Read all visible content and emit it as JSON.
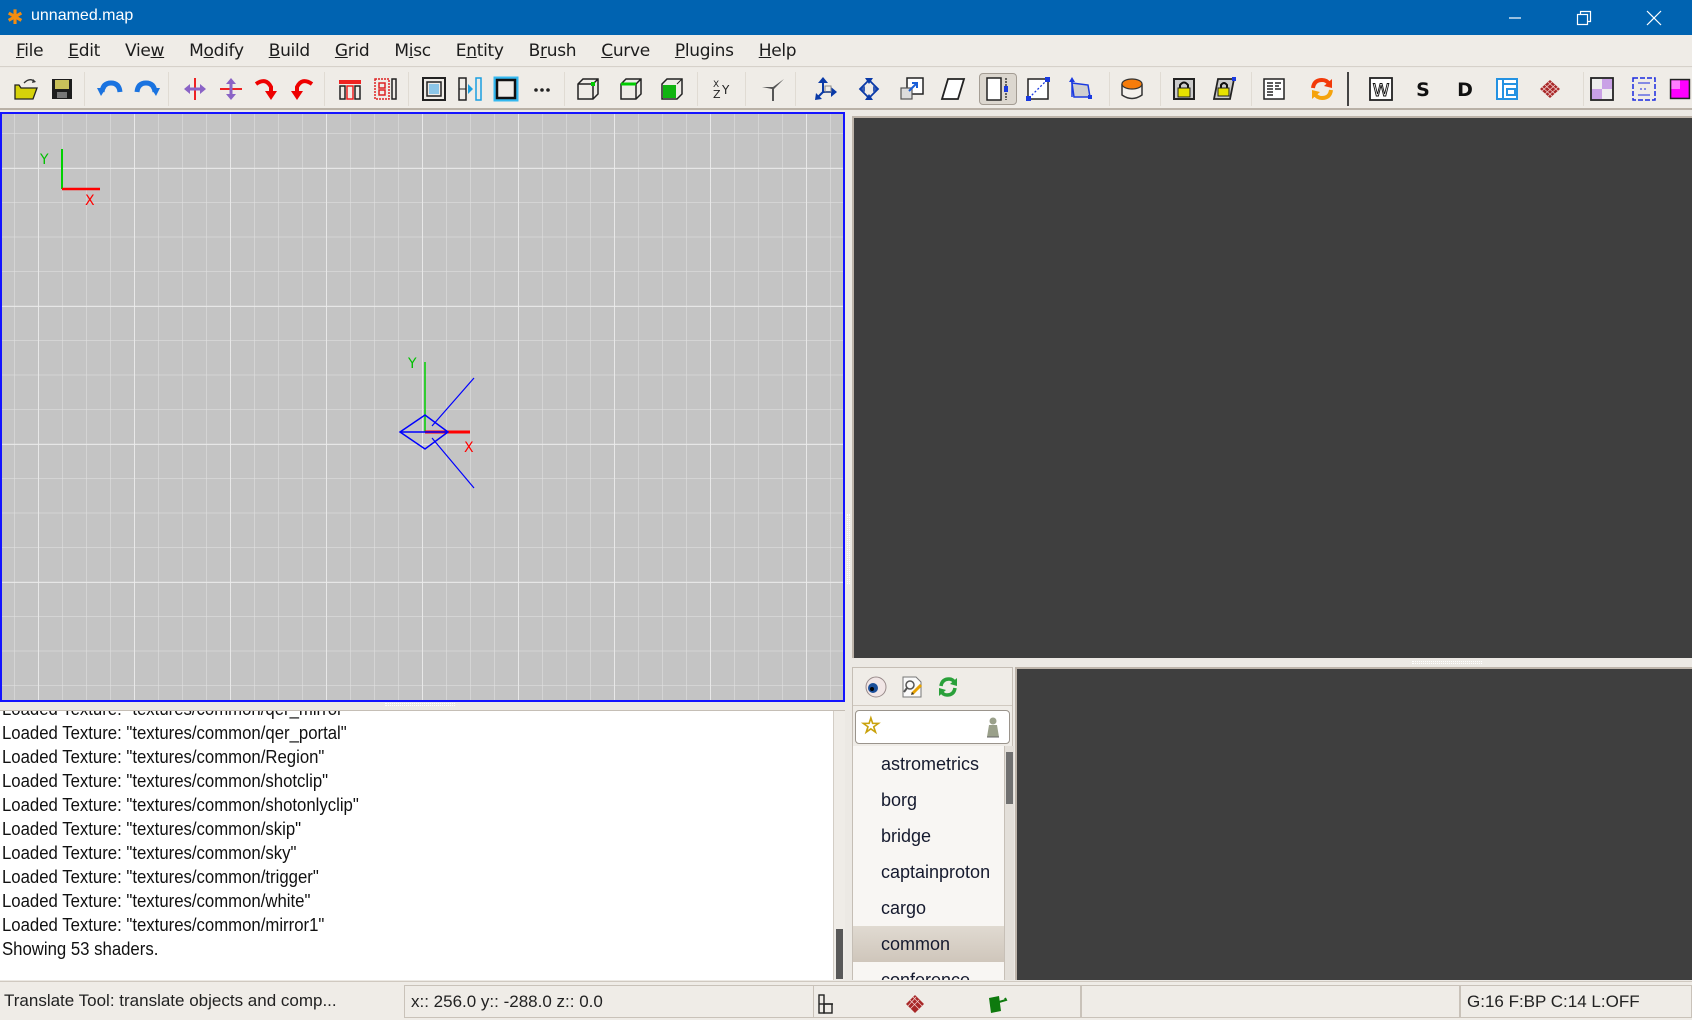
{
  "window": {
    "title": "unnamed.map",
    "app_icon": "radiant-asterisk-icon",
    "controls": [
      "minimize",
      "restore",
      "close"
    ]
  },
  "menubar": {
    "items": [
      {
        "label": "File",
        "mnemonic": "F"
      },
      {
        "label": "Edit",
        "mnemonic": "E"
      },
      {
        "label": "View",
        "mnemonic": "w"
      },
      {
        "label": "Modify",
        "mnemonic": "o"
      },
      {
        "label": "Build",
        "mnemonic": "B"
      },
      {
        "label": "Grid",
        "mnemonic": "G"
      },
      {
        "label": "Misc",
        "mnemonic": "i"
      },
      {
        "label": "Entity",
        "mnemonic": "n"
      },
      {
        "label": "Brush",
        "mnemonic": "r"
      },
      {
        "label": "Curve",
        "mnemonic": "C"
      },
      {
        "label": "Plugins",
        "mnemonic": "P"
      },
      {
        "label": "Help",
        "mnemonic": "H"
      }
    ]
  },
  "toolbar": {
    "buttons": [
      {
        "name": "open",
        "icon": "open-folder-icon"
      },
      {
        "name": "save",
        "icon": "save-floppy-icon"
      },
      {
        "name": "undo",
        "icon": "undo-icon"
      },
      {
        "name": "redo",
        "icon": "redo-icon"
      },
      {
        "name": "flip-x",
        "icon": "flip-x-icon"
      },
      {
        "name": "flip-y",
        "icon": "flip-y-icon"
      },
      {
        "name": "rotate-cw",
        "icon": "rotate-clockwise-icon"
      },
      {
        "name": "rotate-ccw",
        "icon": "rotate-counterclockwise-icon"
      },
      {
        "name": "csg-subtract",
        "icon": "csg-subtract-icon"
      },
      {
        "name": "csg-merge",
        "icon": "csg-merge-icon"
      },
      {
        "name": "make-hollow",
        "icon": "make-hollow-icon"
      },
      {
        "name": "clipper",
        "icon": "clipper-icon"
      },
      {
        "name": "select-inside",
        "icon": "select-inside-icon"
      },
      {
        "name": "select-complete-tall",
        "icon": "dots-icon"
      },
      {
        "name": "view-xy-cube",
        "icon": "cube-corner-icon"
      },
      {
        "name": "view-xz-cube",
        "icon": "cube-edge-icon"
      },
      {
        "name": "view-cube-filled",
        "icon": "cube-filled-icon"
      },
      {
        "name": "change-views",
        "icon": "xyz-views-icon"
      },
      {
        "name": "cubic-clip",
        "icon": "camera-clip-icon"
      },
      {
        "name": "translate",
        "icon": "translate-icon"
      },
      {
        "name": "rotate",
        "icon": "rotate-tool-icon"
      },
      {
        "name": "scale",
        "icon": "scale-icon"
      },
      {
        "name": "skew",
        "icon": "skew-icon"
      },
      {
        "name": "resize",
        "icon": "resize-icon",
        "active": true
      },
      {
        "name": "clip-drag",
        "icon": "clip-plane-icon"
      },
      {
        "name": "texture-project",
        "icon": "texture-project-icon"
      },
      {
        "name": "patch",
        "icon": "patch-cylinder-icon"
      },
      {
        "name": "texture-lock",
        "icon": "texture-lock-icon"
      },
      {
        "name": "texture-scale-lock",
        "icon": "texture-scale-lock-icon"
      },
      {
        "name": "entity-list",
        "icon": "entity-list-icon"
      },
      {
        "name": "refresh-shaders",
        "icon": "refresh-icon"
      },
      {
        "name": "show-worldspawn",
        "icon": "w-letter-icon",
        "text": "W"
      },
      {
        "name": "show-structural",
        "icon": "s-letter-icon",
        "text": "S"
      },
      {
        "name": "show-detail",
        "icon": "d-letter-icon",
        "text": "D"
      },
      {
        "name": "filter-hint",
        "icon": "hint-brush-icon"
      },
      {
        "name": "filter-patches",
        "icon": "patch-mesh-icon"
      },
      {
        "name": "show-caulk",
        "icon": "caulk-checker-icon"
      },
      {
        "name": "show-clip",
        "icon": "clip-brush-icon"
      },
      {
        "name": "show-missing",
        "icon": "missing-texture-icon"
      }
    ]
  },
  "view2d": {
    "axes_legend": {
      "vertical": "Y",
      "horizontal": "X"
    },
    "origin_axes": {
      "vertical": "Y",
      "horizontal": "X"
    },
    "colors": {
      "x_axis": "#ff0000",
      "y_axis": "#00d000",
      "selection_frame": "#1414ff",
      "camera": "#0000ff"
    }
  },
  "console": {
    "partial_first_line": "Loaded Texture: \"textures/common/qer_mirror\"",
    "lines": [
      "Loaded Texture: \"textures/common/qer_portal\"",
      "Loaded Texture: \"textures/common/Region\"",
      "Loaded Texture: \"textures/common/shotclip\"",
      "Loaded Texture: \"textures/common/shotonlyclip\"",
      "Loaded Texture: \"textures/common/skip\"",
      "Loaded Texture: \"textures/common/sky\"",
      "Loaded Texture: \"textures/common/trigger\"",
      "Loaded Texture: \"textures/common/white\"",
      "Loaded Texture: \"textures/common/mirror1\"",
      "Showing 53 shaders."
    ]
  },
  "texture_browser": {
    "toolbar_icons": [
      "eye-icon",
      "find-replace-icon",
      "refresh-icon"
    ],
    "filter": {
      "value": "",
      "placeholder": ""
    },
    "folders": [
      "astrometrics",
      "borg",
      "bridge",
      "captainproton",
      "cargo",
      "common",
      "conference"
    ],
    "selected_folder": "common"
  },
  "statusbar": {
    "tool_hint": "Translate Tool: translate objects and comp...",
    "coords": "x::  256.0  y:: -288.0  z::    0.0",
    "info": "G:16  F:BP  C:14  L:OFF"
  }
}
